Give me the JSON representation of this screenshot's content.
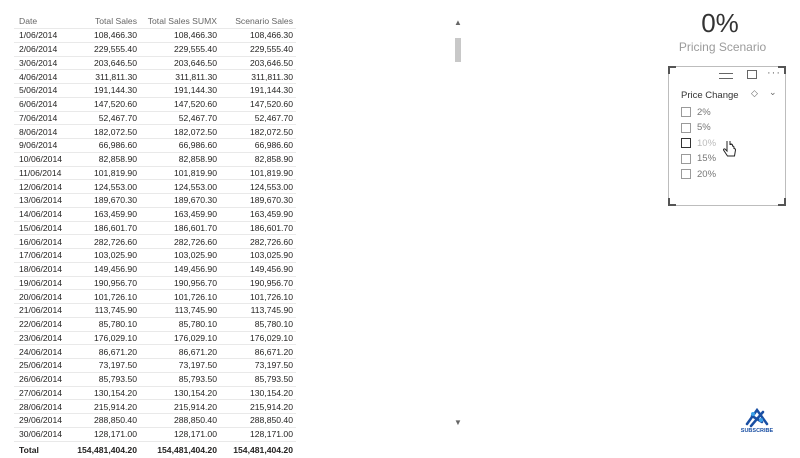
{
  "table": {
    "columns": [
      "Date",
      "Total Sales",
      "Total Sales SUMX",
      "Scenario Sales"
    ],
    "rows": [
      [
        "1/06/2014",
        "108,466.30",
        "108,466.30",
        "108,466.30"
      ],
      [
        "2/06/2014",
        "229,555.40",
        "229,555.40",
        "229,555.40"
      ],
      [
        "3/06/2014",
        "203,646.50",
        "203,646.50",
        "203,646.50"
      ],
      [
        "4/06/2014",
        "311,811.30",
        "311,811.30",
        "311,811.30"
      ],
      [
        "5/06/2014",
        "191,144.30",
        "191,144.30",
        "191,144.30"
      ],
      [
        "6/06/2014",
        "147,520.60",
        "147,520.60",
        "147,520.60"
      ],
      [
        "7/06/2014",
        "52,467.70",
        "52,467.70",
        "52,467.70"
      ],
      [
        "8/06/2014",
        "182,072.50",
        "182,072.50",
        "182,072.50"
      ],
      [
        "9/06/2014",
        "66,986.60",
        "66,986.60",
        "66,986.60"
      ],
      [
        "10/06/2014",
        "82,858.90",
        "82,858.90",
        "82,858.90"
      ],
      [
        "11/06/2014",
        "101,819.90",
        "101,819.90",
        "101,819.90"
      ],
      [
        "12/06/2014",
        "124,553.00",
        "124,553.00",
        "124,553.00"
      ],
      [
        "13/06/2014",
        "189,670.30",
        "189,670.30",
        "189,670.30"
      ],
      [
        "14/06/2014",
        "163,459.90",
        "163,459.90",
        "163,459.90"
      ],
      [
        "15/06/2014",
        "186,601.70",
        "186,601.70",
        "186,601.70"
      ],
      [
        "16/06/2014",
        "282,726.60",
        "282,726.60",
        "282,726.60"
      ],
      [
        "17/06/2014",
        "103,025.90",
        "103,025.90",
        "103,025.90"
      ],
      [
        "18/06/2014",
        "149,456.90",
        "149,456.90",
        "149,456.90"
      ],
      [
        "19/06/2014",
        "190,956.70",
        "190,956.70",
        "190,956.70"
      ],
      [
        "20/06/2014",
        "101,726.10",
        "101,726.10",
        "101,726.10"
      ],
      [
        "21/06/2014",
        "113,745.90",
        "113,745.90",
        "113,745.90"
      ],
      [
        "22/06/2014",
        "85,780.10",
        "85,780.10",
        "85,780.10"
      ],
      [
        "23/06/2014",
        "176,029.10",
        "176,029.10",
        "176,029.10"
      ],
      [
        "24/06/2014",
        "86,671.20",
        "86,671.20",
        "86,671.20"
      ],
      [
        "25/06/2014",
        "73,197.50",
        "73,197.50",
        "73,197.50"
      ],
      [
        "26/06/2014",
        "85,793.50",
        "85,793.50",
        "85,793.50"
      ],
      [
        "27/06/2014",
        "130,154.20",
        "130,154.20",
        "130,154.20"
      ],
      [
        "28/06/2014",
        "215,914.20",
        "215,914.20",
        "215,914.20"
      ],
      [
        "29/06/2014",
        "288,850.40",
        "288,850.40",
        "288,850.40"
      ],
      [
        "30/06/2014",
        "128,171.00",
        "128,171.00",
        "128,171.00"
      ]
    ],
    "total": [
      "Total",
      "154,481,404.20",
      "154,481,404.20",
      "154,481,404.20"
    ]
  },
  "scrollbar": {
    "up_icon": "chevron-up-icon",
    "down_icon": "chevron-down-icon"
  },
  "card": {
    "value": "0%",
    "label": "Pricing Scenario"
  },
  "slicer": {
    "title": "Price Change",
    "options": [
      "2%",
      "5%",
      "10%",
      "15%",
      "20%"
    ],
    "hovered_option": "10%",
    "more_label": "···"
  },
  "logo": {
    "text": "SUBSCRIBE"
  },
  "colors": {
    "accent": "#1a4fa3",
    "border": "#bdbdbd",
    "muted": "#9b9b9b"
  }
}
